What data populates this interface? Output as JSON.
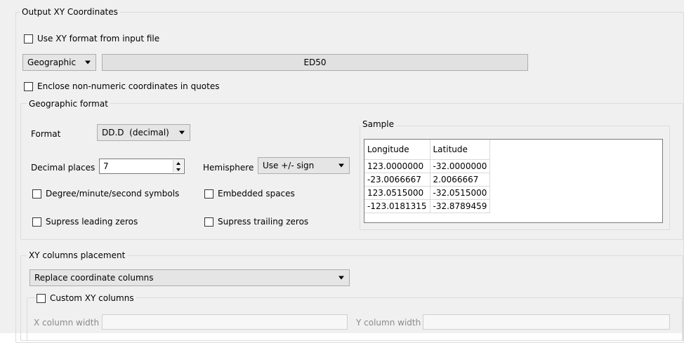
{
  "output_group": {
    "legend": "Output XY Coordinates",
    "use_xy_format_label": "Use XY format from input file",
    "coord_type_value": "Geographic",
    "datum_button_label": "ED50",
    "enclose_label": "Enclose non-numeric coordinates in quotes"
  },
  "geo_format": {
    "legend": "Geographic format",
    "format_label": "Format",
    "format_value": "DD.D  (decimal)",
    "decimal_places_label": "Decimal places",
    "decimal_places_value": "7",
    "hemisphere_label": "Hemisphere",
    "hemisphere_value": "Use +/- sign",
    "dms_symbols_label": "Degree/minute/second symbols",
    "embedded_spaces_label": "Embedded spaces",
    "supress_leading_label": "Supress leading zeros",
    "supress_trailing_label": "Supress trailing zeros"
  },
  "sample": {
    "legend": "Sample",
    "headers": [
      "Longitude",
      "Latitude"
    ],
    "rows": [
      [
        "123.0000000",
        "-32.0000000"
      ],
      [
        "-23.0066667",
        "2.0066667"
      ],
      [
        "123.0515000",
        "-32.0515000"
      ],
      [
        "-123.0181315",
        "-32.8789459"
      ]
    ]
  },
  "xy_placement": {
    "legend": "XY columns placement",
    "placement_value": "Replace coordinate columns",
    "custom_label": "Custom XY columns",
    "x_width_label": "X column width",
    "y_width_label": "Y column width"
  }
}
